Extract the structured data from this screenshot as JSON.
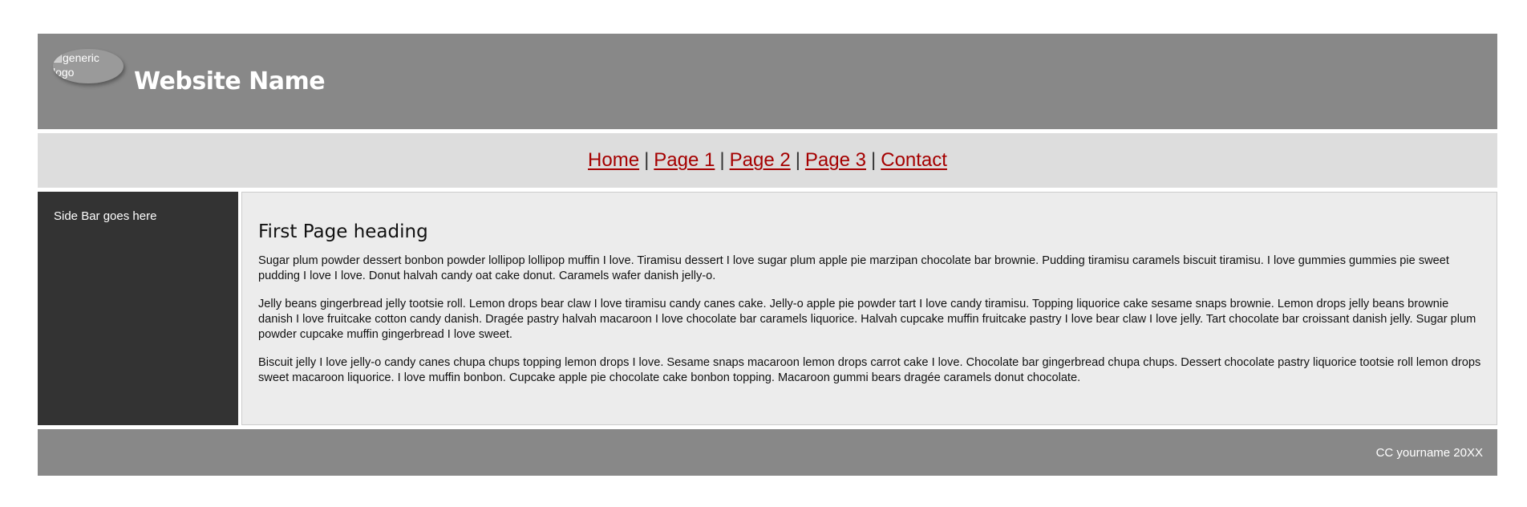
{
  "header": {
    "logo_alt": "generic logo",
    "site_name": "Website Name"
  },
  "nav": {
    "items": [
      "Home",
      "Page 1",
      "Page 2",
      "Page 3",
      "Contact"
    ],
    "separator": "|"
  },
  "sidebar": {
    "text": "Side Bar goes here"
  },
  "main": {
    "heading": "First Page heading",
    "paragraphs": [
      "Sugar plum powder dessert bonbon powder lollipop lollipop muffin I love. Tiramisu dessert I love sugar plum apple pie marzipan chocolate bar brownie. Pudding tiramisu caramels biscuit tiramisu. I love gummies gummies pie sweet pudding I love I love. Donut halvah candy oat cake donut. Caramels wafer danish jelly-o.",
      "Jelly beans gingerbread jelly tootsie roll. Lemon drops bear claw I love tiramisu candy canes cake. Jelly-o apple pie powder tart I love candy tiramisu. Topping liquorice cake sesame snaps brownie. Lemon drops jelly beans brownie danish I love fruitcake cotton candy danish. Dragée pastry halvah macaroon I love chocolate bar caramels liquorice. Halvah cupcake muffin fruitcake pastry I love bear claw I love jelly. Tart chocolate bar croissant danish jelly. Sugar plum powder cupcake muffin gingerbread I love sweet.",
      "Biscuit jelly I love jelly-o candy canes chupa chups topping lemon drops I love. Sesame snaps macaroon lemon drops carrot cake I love. Chocolate bar gingerbread chupa chups. Dessert chocolate pastry liquorice tootsie roll lemon drops sweet macaroon liquorice. I love muffin bonbon. Cupcake apple pie chocolate cake bonbon topping. Macaroon gummi bears dragée caramels donut chocolate."
    ]
  },
  "footer": {
    "text": "CC yourname 20XX"
  },
  "colors": {
    "header_bg": "#888888",
    "nav_bg": "#dddddd",
    "link": "#a50000",
    "sidebar_bg": "#333333",
    "main_bg": "#ececec",
    "footer_bg": "#888888"
  }
}
